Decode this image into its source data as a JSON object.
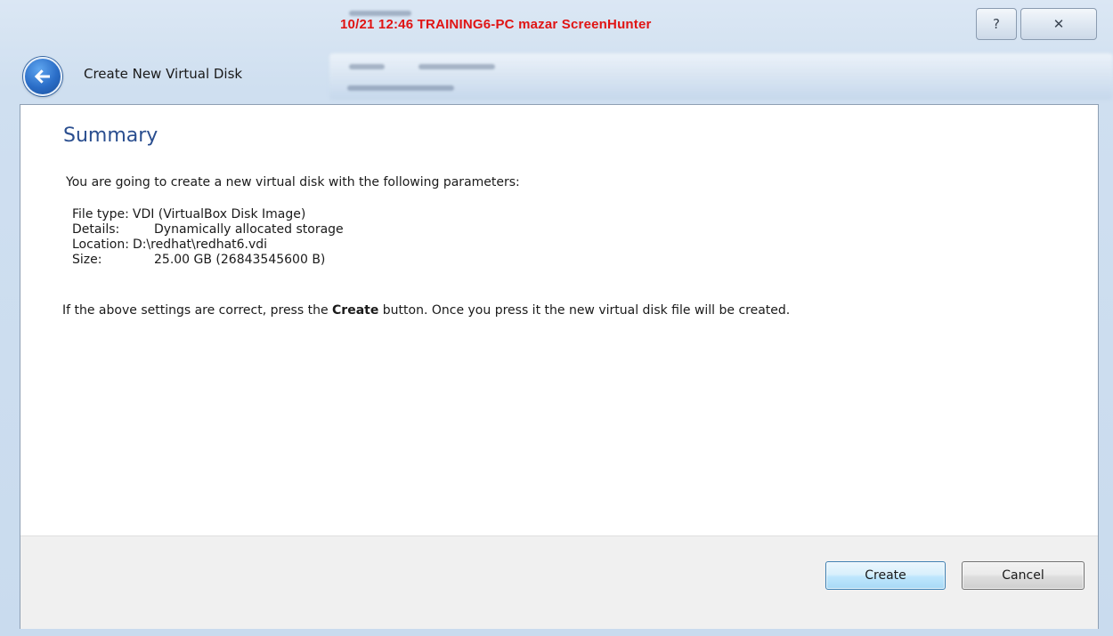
{
  "overlay": {
    "text": "10/21  12:46  TRAINING6-PC  mazar  ScreenHunter"
  },
  "titlebar": {
    "help_glyph": "?",
    "close_glyph": "✕"
  },
  "header": {
    "back_icon": "back-arrow-icon",
    "title": "Create New Virtual Disk"
  },
  "summary": {
    "heading": "Summary",
    "intro": "You are going to create a new virtual disk with the following parameters:",
    "params": [
      {
        "label": "File type:",
        "value": "VDI (VirtualBox Disk Image)"
      },
      {
        "label": "Details:",
        "value": "Dynamically allocated storage"
      },
      {
        "label": "Location:",
        "value": "D:\\redhat\\redhat6.vdi"
      },
      {
        "label": "Size:",
        "value": "25.00 GB (26843545600 B)"
      }
    ],
    "confirm_before": "If the above settings are correct, press the ",
    "confirm_bold": "Create",
    "confirm_after": " button. Once you press it the new virtual disk file will be created."
  },
  "buttons": {
    "create": "Create",
    "cancel": "Cancel"
  },
  "colors": {
    "heading": "#2a4e8f",
    "overlay_text": "#e01414",
    "default_button_border": "#3c7fb1"
  }
}
